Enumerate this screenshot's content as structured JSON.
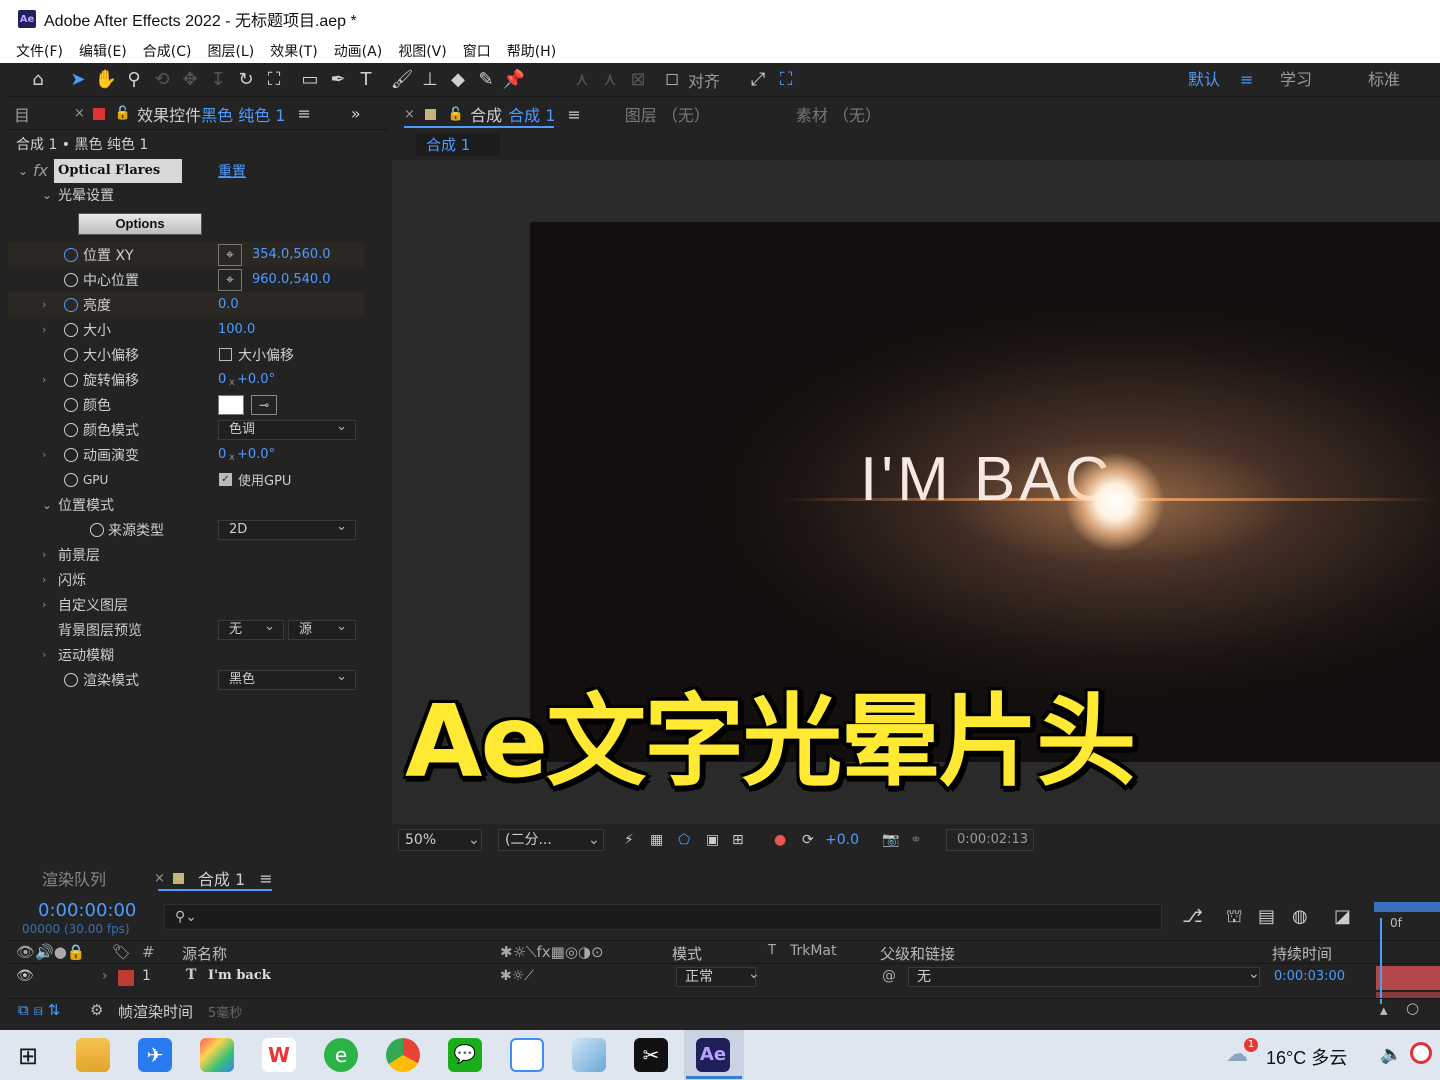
{
  "titlebar": {
    "title": "Adobe After Effects 2022 - 无标题项目.aep *",
    "logo": "Ae"
  },
  "menu": [
    "文件(F)",
    "编辑(E)",
    "合成(C)",
    "图层(L)",
    "效果(T)",
    "动画(A)",
    "视图(V)",
    "窗口",
    "帮助(H)"
  ],
  "toolbar": {
    "align_label": "对齐",
    "workspaces": [
      "默认",
      "学习",
      "标准"
    ]
  },
  "effects_panel": {
    "tab_prefix": "目",
    "tab_label": "效果控件",
    "tab_layer": "黑色 纯色 1",
    "breadcrumb": "合成 1 • 黑色 纯色 1",
    "effect_name": "Optical Flares",
    "reset": "重置",
    "group_halo": "光晕设置",
    "options_button": "Options",
    "props": [
      {
        "label": "位置 XY",
        "value": "354.0,560.0"
      },
      {
        "label": "中心位置",
        "value": "960.0,540.0"
      },
      {
        "label": "亮度",
        "value": "0.0"
      },
      {
        "label": "大小",
        "value": "100.0"
      },
      {
        "label": "大小偏移",
        "value": "大小偏移"
      },
      {
        "label": "旋转偏移",
        "value_a": "0",
        "value_x": "x",
        "value_b": "+0.0°"
      },
      {
        "label": "颜色"
      },
      {
        "label": "颜色模式",
        "value": "色调"
      },
      {
        "label": "动画演变",
        "value_a": "0",
        "value_x": "x",
        "value_b": "+0.0°"
      },
      {
        "label": "GPU",
        "value": "使用GPU"
      }
    ],
    "group_position": "位置模式",
    "source_type_label": "来源类型",
    "source_type_value": "2D",
    "groups": [
      "前景层",
      "闪烁",
      "自定义图层"
    ],
    "bg_preview_label": "背景图层预览",
    "bg_preview_a": "无",
    "bg_preview_b": "源",
    "motion_blur": "运动模糊",
    "render_mode_label": "渲染模式",
    "render_mode_value": "黑色"
  },
  "viewer": {
    "tab_comp": "合成",
    "tab_comp_name": "合成 1",
    "tab_layer": "图层 （无）",
    "tab_footage": "素材 （无）",
    "sub_tab": "合成 1",
    "canvas_text": "I'M BAC",
    "zoom": "50%",
    "resolution": "(二分...",
    "exposure": "+0.0",
    "timecode": "0:00:02:13"
  },
  "overlay_title": "Ae文字光晕片头",
  "timeline": {
    "tab_render": "渲染队列",
    "tab_comp": "合成 1",
    "timecode": "0:00:00:00",
    "fps": "00000 (30.00 fps)",
    "search_placeholder": "",
    "col_hash": "#",
    "col_source": "源名称",
    "col_mode": "模式",
    "col_t": "T",
    "col_trkmat": "TrkMat",
    "col_parent": "父级和链接",
    "col_duration": "持续时间",
    "ruler_label": "0f",
    "layers": [
      {
        "num": "1",
        "name": "I'm back",
        "mode": "正常",
        "parent": "无",
        "duration": "0:00:03:00"
      }
    ],
    "footer_label": "帧渲染时间",
    "footer_value": "5毫秒"
  },
  "taskbar": {
    "weather": "16°C  多云",
    "badge": "1",
    "apps": [
      "file-explorer",
      "feishu",
      "app-grid",
      "wps",
      "browser-360",
      "chrome",
      "wechat",
      "baidu-netdisk",
      "notes",
      "capcut",
      "after-effects"
    ]
  },
  "colors": {
    "accent": "#4d9bff",
    "title_yellow": "#ffe933",
    "layer_red": "#c23b3b"
  }
}
